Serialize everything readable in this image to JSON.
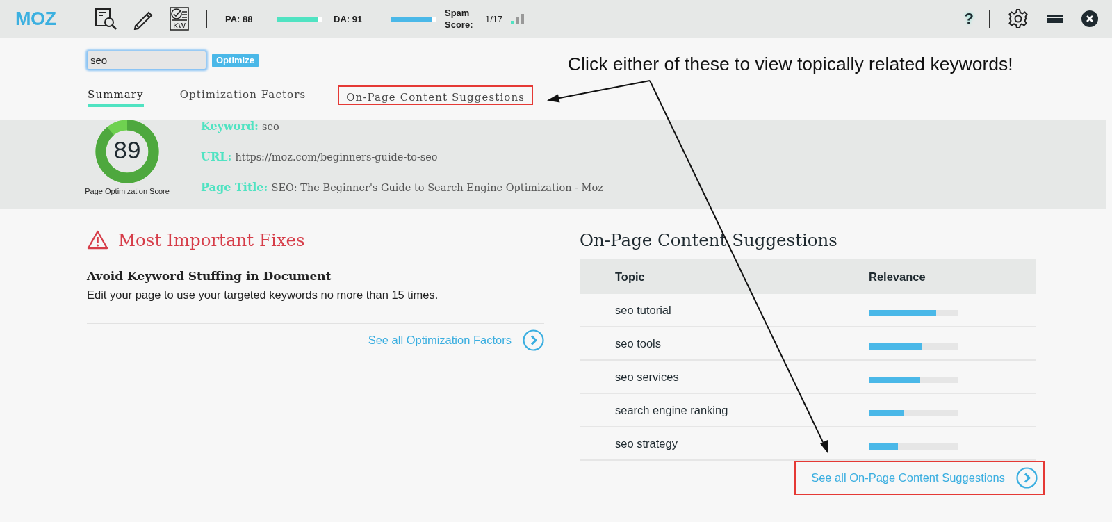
{
  "toolbar": {
    "logo": "MOZ",
    "tools": [
      {
        "kind": "page-search"
      },
      {
        "kind": "edit"
      },
      {
        "kind": "keyword-check",
        "label": "KW"
      }
    ],
    "metrics": [
      {
        "label": "PA: 88",
        "level": 0.9,
        "color": "#50e3c2"
      },
      {
        "label": "DA: 91",
        "level": 0.9,
        "color": "#4ab8e8"
      }
    ],
    "spam": {
      "label": "Spam Score:",
      "value": "1/17"
    },
    "actions": [
      {
        "kind": "help",
        "text": "?"
      },
      {
        "kind": "settings"
      },
      {
        "kind": "minimize"
      },
      {
        "kind": "close"
      }
    ]
  },
  "search": {
    "value": "seo",
    "button": "Optimize"
  },
  "tabs": [
    {
      "label": "Summary",
      "selected": true,
      "highlighted": false
    },
    {
      "label": "Optimization Factors",
      "selected": false,
      "highlighted": false
    },
    {
      "label": "On-Page Content Suggestions",
      "selected": false,
      "highlighted": true
    }
  ],
  "summary": {
    "score": "89",
    "score_label": "Page Optimization Score",
    "fields": [
      {
        "label": "Keyword:",
        "value": "seo"
      },
      {
        "label": "URL:",
        "value": "https://moz.com/beginners-guide-to-seo"
      },
      {
        "label": "Page Title:",
        "value": "SEO: The Beginner's Guide to Search Engine Optimization - Moz"
      }
    ]
  },
  "fixes": {
    "title": "Most Important Fixes",
    "items": [
      {
        "title": "Avoid Keyword Stuffing in Document",
        "text": "Edit your page to use your targeted keywords no more than 15 times."
      }
    ],
    "link": {
      "text": "See all Optimization Factors",
      "highlighted": false
    }
  },
  "suggestions": {
    "title": "On-Page Content Suggestions",
    "columns": [
      "Topic",
      "Relevance"
    ],
    "rows": [
      {
        "topic": "seo tutorial",
        "level": 0.76
      },
      {
        "topic": "seo tools",
        "level": 0.59
      },
      {
        "topic": "seo services",
        "level": 0.58
      },
      {
        "topic": "search engine ranking",
        "level": 0.4
      },
      {
        "topic": "seo strategy",
        "level": 0.33
      }
    ],
    "link": {
      "text": "See all On-Page Content Suggestions",
      "highlighted": true
    }
  },
  "annotation": {
    "text": "Click either of these to view topically related keywords!"
  }
}
